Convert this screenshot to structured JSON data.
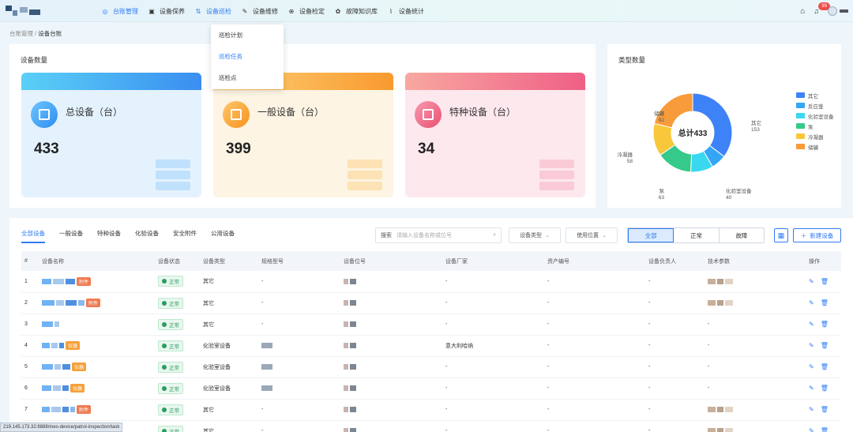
{
  "nav": {
    "items": [
      {
        "label": "台账管理",
        "icon": "ledger-icon"
      },
      {
        "label": "设备保养",
        "icon": "maintenance-icon"
      },
      {
        "label": "设备巡检",
        "icon": "inspection-icon"
      },
      {
        "label": "设备维修",
        "icon": "wrench-icon"
      },
      {
        "label": "设备检定",
        "icon": "calibration-icon"
      },
      {
        "label": "故障知识库",
        "icon": "knowledge-icon"
      },
      {
        "label": "设备统计",
        "icon": "chart-icon"
      }
    ],
    "notify_count": "99"
  },
  "dropdown": {
    "items": [
      "巡检计划",
      "巡检任务",
      "巡检点"
    ]
  },
  "breadcrumb": {
    "root": "台账管理",
    "current": "设备台账"
  },
  "summary": {
    "title": "设备数量",
    "cards": [
      {
        "label": "总设备（台）",
        "value": "433",
        "color": "#3a9bf0"
      },
      {
        "label": "一般设备（台）",
        "value": "399",
        "color": "#f5a13a"
      },
      {
        "label": "特种设备（台）",
        "value": "34",
        "color": "#ee6b8b"
      }
    ]
  },
  "chart_data": {
    "type": "pie",
    "title": "类型数量",
    "center_label": "总计433",
    "categories": [
      "其它",
      "反应釜",
      "化验室设备",
      "泵",
      "冷凝器",
      "储罐"
    ],
    "values": [
      153,
      null,
      40,
      63,
      58,
      92
    ],
    "shown_labels": [
      {
        "name": "其它",
        "value": "153"
      },
      {
        "name": "化验室设备",
        "value": "40"
      },
      {
        "name": "泵",
        "value": "63"
      },
      {
        "name": "冷凝器",
        "value": "58"
      },
      {
        "name": "储罐",
        "value": "92"
      }
    ],
    "colors": [
      "#3e82f7",
      "#35a6f4",
      "#3ad7f0",
      "#35c98a",
      "#f8c83a",
      "#f89b3a"
    ],
    "legend": "right"
  },
  "tabs": [
    "全部设备",
    "一般设备",
    "特种设备",
    "化验设备",
    "安全附件",
    "公用设备"
  ],
  "search": {
    "label": "搜索",
    "placeholder": "请输入设备名称或位号"
  },
  "filters": {
    "type": "设备类型",
    "location": "使用位置"
  },
  "segment": [
    "全部",
    "正常",
    "故障"
  ],
  "new_button": "新建设备",
  "table": {
    "columns": [
      "#",
      "设备名称",
      "设备状态",
      "设备类型",
      "规格型号",
      "设备位号",
      "设备厂家",
      "资产编号",
      "设备负责人",
      "技术参数",
      "操作"
    ],
    "rows": [
      {
        "idx": "1",
        "tag": "附件",
        "tag_color": "#f07b52",
        "status": "正常",
        "type": "其它",
        "spec": "-",
        "maker": "-",
        "asset": "-",
        "owner": "-"
      },
      {
        "idx": "2",
        "tag": "附件",
        "tag_color": "#f07b52",
        "status": "正常",
        "type": "其它",
        "spec": "-",
        "maker": "-",
        "asset": "-",
        "owner": "-"
      },
      {
        "idx": "3",
        "tag": "",
        "tag_color": "",
        "status": "正常",
        "type": "其它",
        "spec": "-",
        "maker": "-",
        "asset": "-",
        "owner": "-",
        "tech": "-"
      },
      {
        "idx": "4",
        "tag": "仪器",
        "tag_color": "#f5a13a",
        "status": "正常",
        "type": "化验室设备",
        "spec": "",
        "maker": "意大利哈纳",
        "asset": "-",
        "owner": "-",
        "tech": "-"
      },
      {
        "idx": "5",
        "tag": "仪器",
        "tag_color": "#f5a13a",
        "status": "正常",
        "type": "化验室设备",
        "spec": "",
        "maker": "-",
        "asset": "-",
        "owner": "-",
        "tech": "-"
      },
      {
        "idx": "6",
        "tag": "仪器",
        "tag_color": "#f5a13a",
        "status": "正常",
        "type": "化验室设备",
        "spec": "",
        "maker": "-",
        "asset": "-",
        "owner": "-",
        "tech": "-"
      },
      {
        "idx": "7",
        "tag": "附件",
        "tag_color": "#f07b52",
        "status": "正常",
        "type": "其它",
        "spec": "-",
        "maker": "-",
        "asset": "-",
        "owner": "-"
      },
      {
        "idx": "",
        "tag": "",
        "tag_color": "",
        "status": "正常",
        "type": "其它",
        "spec": "-",
        "maker": "-",
        "asset": "-",
        "owner": "-"
      }
    ]
  },
  "status_url": "219.145.173.32:8888/mes-device/patrol-inspection/task"
}
